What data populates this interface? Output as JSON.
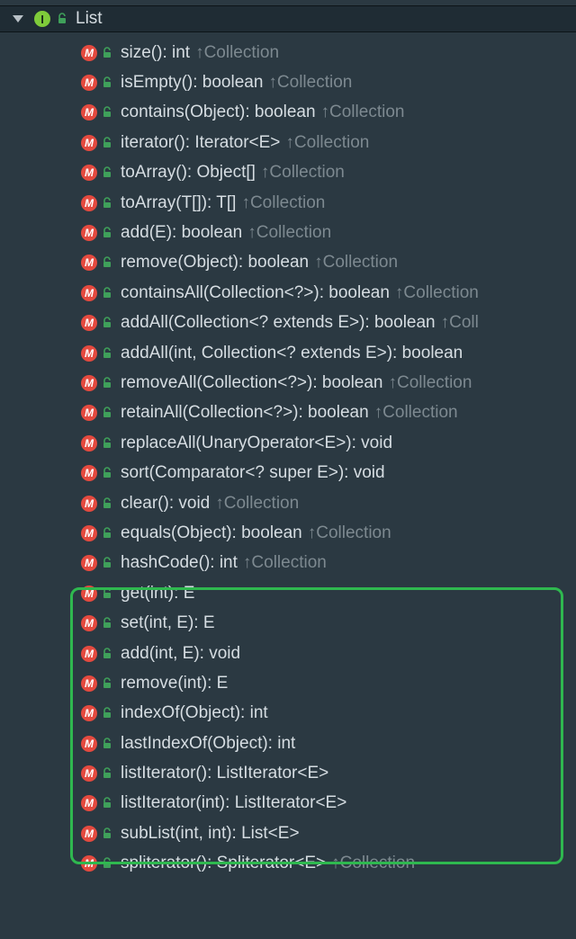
{
  "header": {
    "interface_letter": "I",
    "name": "List"
  },
  "inherit_prefix": "↑",
  "methods": [
    {
      "signature": "size(): int",
      "inherited_from": "Collection"
    },
    {
      "signature": "isEmpty(): boolean",
      "inherited_from": "Collection"
    },
    {
      "signature": "contains(Object): boolean",
      "inherited_from": "Collection"
    },
    {
      "signature": "iterator(): Iterator<E>",
      "inherited_from": "Collection"
    },
    {
      "signature": "toArray(): Object[]",
      "inherited_from": "Collection"
    },
    {
      "signature": "toArray(T[]): T[]",
      "inherited_from": "Collection"
    },
    {
      "signature": "add(E): boolean",
      "inherited_from": "Collection"
    },
    {
      "signature": "remove(Object): boolean",
      "inherited_from": "Collection"
    },
    {
      "signature": "containsAll(Collection<?>): boolean",
      "inherited_from": "Collection"
    },
    {
      "signature": "addAll(Collection<? extends E>): boolean",
      "inherited_from": "Collection",
      "truncate": true
    },
    {
      "signature": "addAll(int, Collection<? extends E>): boolean",
      "inherited_from": null
    },
    {
      "signature": "removeAll(Collection<?>): boolean",
      "inherited_from": "Collection"
    },
    {
      "signature": "retainAll(Collection<?>): boolean",
      "inherited_from": "Collection"
    },
    {
      "signature": "replaceAll(UnaryOperator<E>): void",
      "inherited_from": null
    },
    {
      "signature": "sort(Comparator<? super E>): void",
      "inherited_from": null
    },
    {
      "signature": "clear(): void",
      "inherited_from": "Collection"
    },
    {
      "signature": "equals(Object): boolean",
      "inherited_from": "Collection"
    },
    {
      "signature": "hashCode(): int",
      "inherited_from": "Collection"
    },
    {
      "signature": "get(int): E",
      "inherited_from": null
    },
    {
      "signature": "set(int, E): E",
      "inherited_from": null
    },
    {
      "signature": "add(int, E): void",
      "inherited_from": null
    },
    {
      "signature": "remove(int): E",
      "inherited_from": null
    },
    {
      "signature": "indexOf(Object): int",
      "inherited_from": null
    },
    {
      "signature": "lastIndexOf(Object): int",
      "inherited_from": null
    },
    {
      "signature": "listIterator(): ListIterator<E>",
      "inherited_from": null
    },
    {
      "signature": "listIterator(int): ListIterator<E>",
      "inherited_from": null
    },
    {
      "signature": "subList(int, int): List<E>",
      "inherited_from": null
    },
    {
      "signature": "spliterator(): Spliterator<E>",
      "inherited_from": "Collection"
    }
  ]
}
